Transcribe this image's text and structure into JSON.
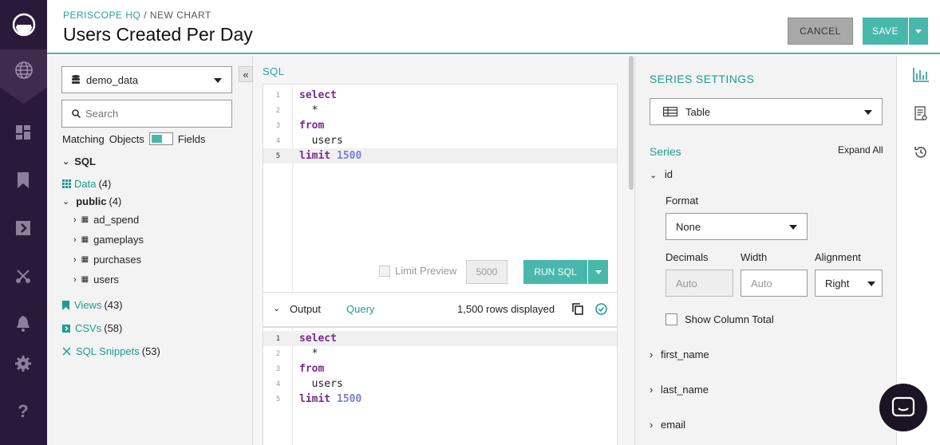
{
  "header": {
    "breadcrumb_root": "PERISCOPE HQ",
    "breadcrumb_sep": " / ",
    "breadcrumb_current": "NEW CHART",
    "title": "Users Created Per Day",
    "cancel_label": "CANCEL",
    "save_label": "SAVE"
  },
  "leftnav": {
    "icons": [
      "periscope-logo",
      "globe-icon",
      "dashboard-icon",
      "bookmark-icon",
      "views-icon",
      "snippets-icon",
      "bell-icon",
      "gear-icon",
      "help-icon"
    ]
  },
  "schema": {
    "database": "demo_data",
    "collapse_label": "«",
    "search_placeholder": "Search",
    "matching_label": "Matching",
    "objects_label": "Objects",
    "fields_label": "Fields",
    "sql_section": "SQL",
    "data_label": "Data",
    "data_count": "(4)",
    "public_label": "public",
    "public_count": "(4)",
    "tables": [
      "ad_spend",
      "gameplays",
      "purchases",
      "users"
    ],
    "views_label": "Views",
    "views_count": "(43)",
    "csvs_label": "CSVs",
    "csvs_count": "(58)",
    "snippets_label": "SQL Snippets",
    "snippets_count": "(53)"
  },
  "editor": {
    "label": "SQL",
    "lines": [
      {
        "n": "1",
        "kw": "select",
        "text": "",
        "num": ""
      },
      {
        "n": "2",
        "kw": "",
        "text": "  *",
        "num": ""
      },
      {
        "n": "3",
        "kw": "from",
        "text": "",
        "num": ""
      },
      {
        "n": "4",
        "kw": "",
        "text": "  users",
        "num": ""
      },
      {
        "n": "5",
        "kw": "limit",
        "text": " ",
        "num": "1500"
      }
    ],
    "limit_preview_label": "Limit Preview",
    "limit_value": "5000",
    "run_label": "RUN SQL"
  },
  "output": {
    "tab_output": "Output",
    "tab_query": "Query",
    "rows_displayed": "1,500 rows displayed"
  },
  "settings": {
    "title": "SERIES SETTINGS",
    "viz_type": "Table",
    "series_label": "Series",
    "expand_all": "Expand All",
    "expanded_series": "id",
    "format_label": "Format",
    "format_value": "None",
    "decimals_label": "Decimals",
    "decimals_placeholder": "Auto",
    "width_label": "Width",
    "width_placeholder": "Auto",
    "alignment_label": "Alignment",
    "alignment_value": "Right",
    "show_total_label": "Show Column Total",
    "collapsed_series": [
      "first_name",
      "last_name",
      "email"
    ]
  },
  "colors": {
    "accent": "#47b8ab",
    "nav_bg": "#2a1a3a",
    "keyword": "#7a2a8c",
    "number": "#7a7fd8"
  }
}
